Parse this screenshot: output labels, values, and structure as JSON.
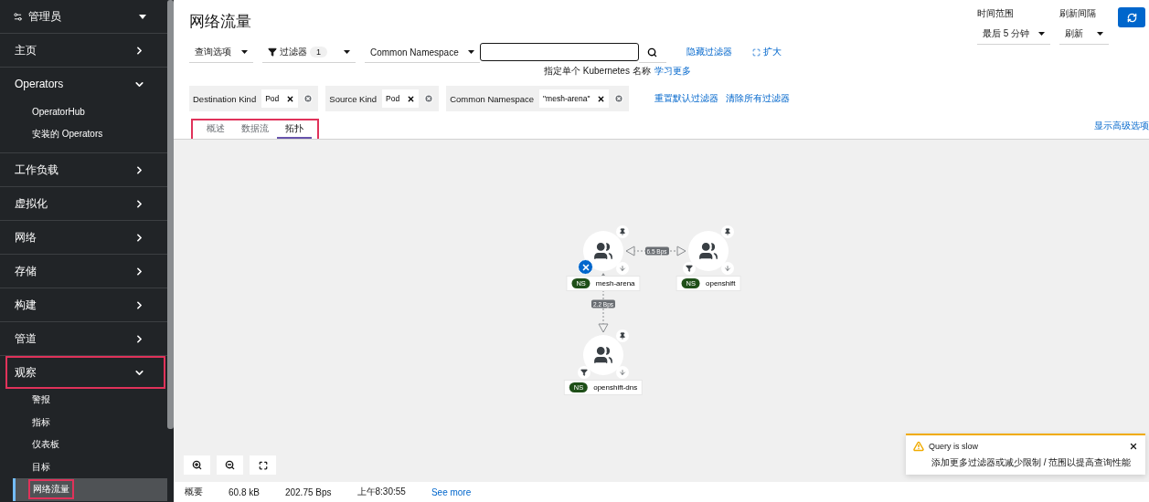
{
  "sidebar": {
    "perspective": "管理员",
    "sections": [
      {
        "label": "主页",
        "expanded": false,
        "annotated": false
      },
      {
        "label": "Operators",
        "expanded": true,
        "annotated": false,
        "children": [
          {
            "label": "OperatorHub",
            "selected": false,
            "annotated": false
          },
          {
            "label": "安装的 Operators",
            "selected": false,
            "annotated": false
          }
        ]
      },
      {
        "label": "工作负载",
        "expanded": false,
        "annotated": false
      },
      {
        "label": "虚拟化",
        "expanded": false,
        "annotated": false
      },
      {
        "label": "网络",
        "expanded": false,
        "annotated": false
      },
      {
        "label": "存储",
        "expanded": false,
        "annotated": false
      },
      {
        "label": "构建",
        "expanded": false,
        "annotated": false
      },
      {
        "label": "管道",
        "expanded": false,
        "annotated": false
      },
      {
        "label": "观察",
        "expanded": true,
        "annotated": true,
        "children": [
          {
            "label": "警报",
            "selected": false,
            "annotated": false
          },
          {
            "label": "指标",
            "selected": false,
            "annotated": false
          },
          {
            "label": "仪表板",
            "selected": false,
            "annotated": false
          },
          {
            "label": "目标",
            "selected": false,
            "annotated": false
          },
          {
            "label": "网络流量",
            "selected": true,
            "annotated": true
          }
        ]
      }
    ]
  },
  "header": {
    "title": "网络流量",
    "time_range": {
      "label": "时间范围",
      "value": "最后 5 分钟"
    },
    "refresh_interval": {
      "label": "刷新间隔",
      "value": "刷新"
    }
  },
  "toolbar": {
    "query_options": "查询选项",
    "filter_button": {
      "label": "过滤器",
      "count": "1"
    },
    "filter_type": "Common Namespace",
    "hint": "指定单个 Kubernetes 名称",
    "hint_link": "学习更多",
    "hide_filters": "隐藏过滤器",
    "expand": "扩大"
  },
  "chips": [
    {
      "category": "Destination Kind",
      "value": "Pod"
    },
    {
      "category": "Source Kind",
      "value": "Pod"
    },
    {
      "category": "Common Namespace",
      "value": "\"mesh-arena\""
    }
  ],
  "chip_links": [
    "重置默认过滤器",
    "清除所有过滤器"
  ],
  "tabs": {
    "annotated": true,
    "items": [
      {
        "label": "概述",
        "selected": false
      },
      {
        "label": "数据流",
        "selected": false
      },
      {
        "label": "拓扑",
        "selected": true
      }
    ]
  },
  "advanced_link": "显示高级选项",
  "topology": {
    "nodes": [
      {
        "badge": "NS",
        "name": "mesh-arena",
        "filter_applied": true
      },
      {
        "badge": "NS",
        "name": "openshift",
        "filter_applied": false
      },
      {
        "badge": "NS",
        "name": "openshift-dns",
        "filter_applied": false
      }
    ],
    "edges": [
      {
        "label": "6.5 Bps",
        "both_ways": true
      },
      {
        "label": "2.2 Bps",
        "both_ways": false
      }
    ]
  },
  "summary": {
    "label": "概要",
    "values": [
      "60.8 kB",
      "202.75 Bps",
      "上午8:30:55"
    ],
    "link": "See more"
  },
  "toast": {
    "title": "Query is slow",
    "message": "添加更多过滤器或减少限制 / 范围以提高查询性能"
  }
}
